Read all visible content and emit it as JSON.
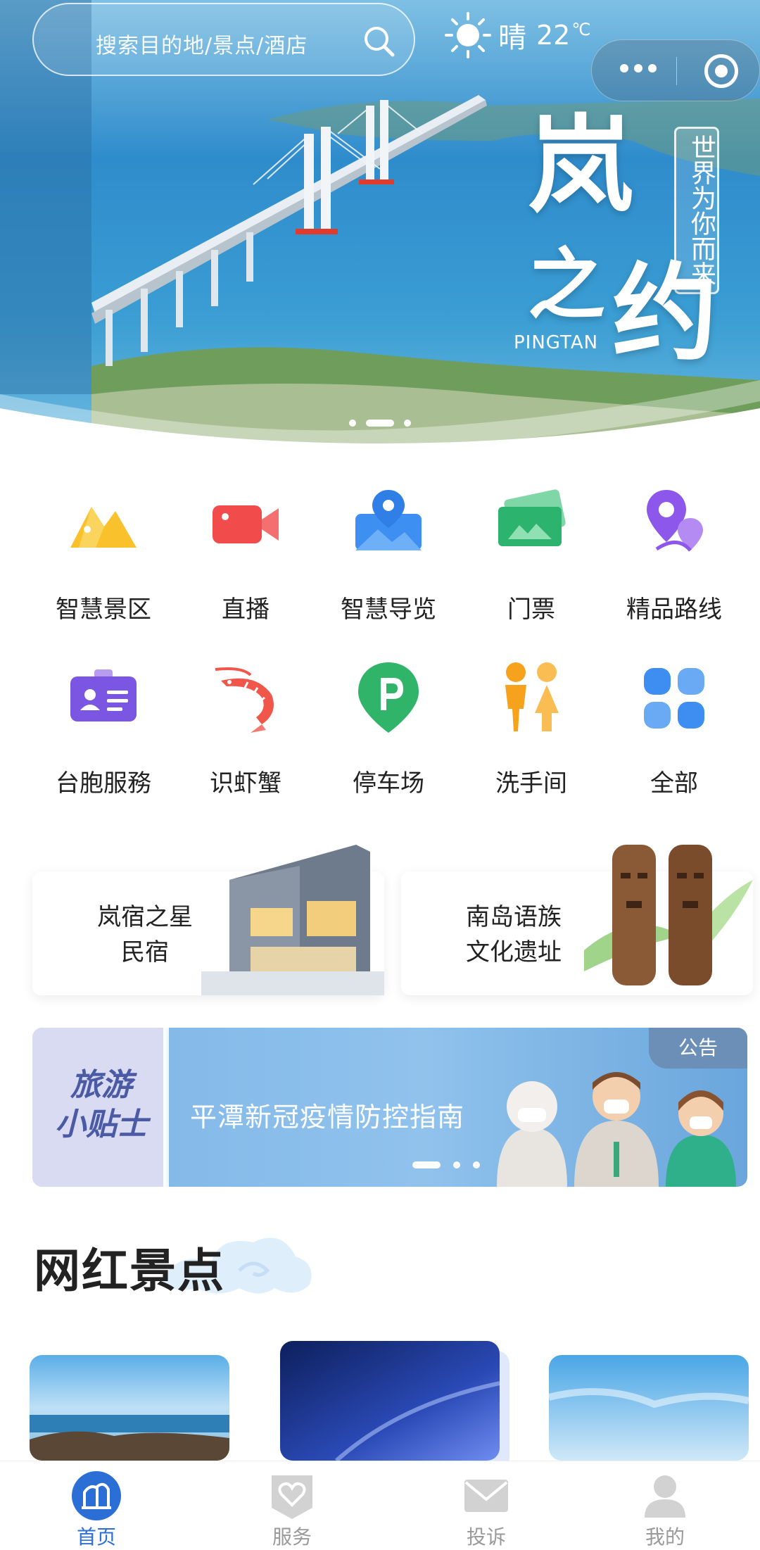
{
  "header": {
    "search_placeholder": "搜索目的地/景点/酒店",
    "weather": {
      "condition": "晴",
      "temperature": "22",
      "unit": "℃"
    }
  },
  "banner": {
    "vertical_text": "世界为你而来",
    "title_chars": [
      "岚",
      "之",
      "约"
    ],
    "english": "PINGTAN",
    "slides_count": 3,
    "active_slide": 2
  },
  "quick_links": [
    {
      "label": "智慧景区",
      "icon": "scenic-mountain-icon",
      "color": "#f7b92d"
    },
    {
      "label": "直播",
      "icon": "video-camera-icon",
      "color": "#f14a4a"
    },
    {
      "label": "智慧导览",
      "icon": "map-pin-icon",
      "color": "#3b8df0"
    },
    {
      "label": "门票",
      "icon": "ticket-icon",
      "color": "#28b06b"
    },
    {
      "label": "精品路线",
      "icon": "route-pin-icon",
      "color": "#8b57e8"
    },
    {
      "label": "台胞服務",
      "icon": "id-card-icon",
      "color": "#7b56e2"
    },
    {
      "label": "识虾蟹",
      "icon": "shrimp-icon",
      "color": "#f0564a"
    },
    {
      "label": "停车场",
      "icon": "parking-icon",
      "color": "#2fb46a"
    },
    {
      "label": "洗手间",
      "icon": "restroom-icon",
      "color": "#f6a21d"
    },
    {
      "label": "全部",
      "icon": "grid-all-icon",
      "color": "#3d8ef0"
    }
  ],
  "cards": [
    {
      "line1": "岚宿之星",
      "line2": "民宿"
    },
    {
      "line1": "南岛语族",
      "line2": "文化遗址"
    }
  ],
  "tips": {
    "left_line1": "旅游",
    "left_line2": "小贴士",
    "message": "平潭新冠疫情防控指南",
    "tag": "公告"
  },
  "section": {
    "title": "网红景点"
  },
  "tabbar": [
    {
      "label": "首页",
      "icon": "home-icon",
      "active": true
    },
    {
      "label": "服务",
      "icon": "heart-service-icon",
      "active": false
    },
    {
      "label": "投诉",
      "icon": "mail-icon",
      "active": false
    },
    {
      "label": "我的",
      "icon": "user-icon",
      "active": false
    }
  ],
  "colors": {
    "accent": "#2b6fd6",
    "inactive_tab": "#9a9a9a"
  }
}
